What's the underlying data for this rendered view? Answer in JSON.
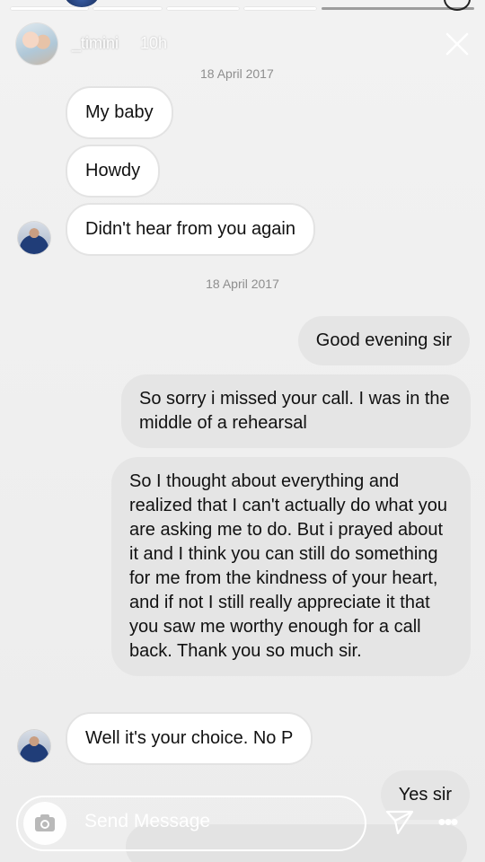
{
  "header": {
    "username": "_timini",
    "time_ago": "10h"
  },
  "dates": [
    "18 April 2017",
    "18 April 2017"
  ],
  "messages": [
    {
      "text": "My baby"
    },
    {
      "text": "Howdy"
    },
    {
      "text": "Didn't hear from you again"
    },
    {
      "text": "Good evening sir"
    },
    {
      "text": "So sorry i missed your call. I was in the middle of a rehearsal"
    },
    {
      "text": "So I thought about everything and realized that I can't actually do what you are asking me to do. But i prayed about it and I think you can still do something for me from the kindness of your heart, and if not I still really appreciate it that you saw me worthy enough for a call back. Thank you so much sir."
    },
    {
      "text": "Well it's your choice. No P"
    },
    {
      "text": "Yes sir"
    }
  ],
  "composer": {
    "placeholder": "Send Message"
  },
  "icons": {
    "close": "close-icon",
    "camera": "camera-icon",
    "send": "send-icon",
    "more": "more-icon"
  }
}
